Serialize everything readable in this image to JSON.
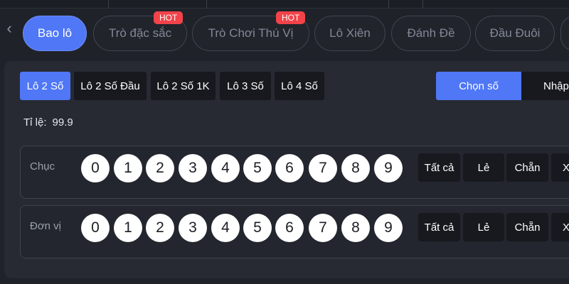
{
  "tabs": [
    {
      "label": "Bao lô",
      "active": true,
      "hot": false
    },
    {
      "label": "Trò đặc sắc",
      "active": false,
      "hot": true
    },
    {
      "label": "Trò Chơi Thú Vị",
      "active": false,
      "hot": true
    },
    {
      "label": "Lô Xiên",
      "active": false,
      "hot": false
    },
    {
      "label": "Đánh Đề",
      "active": false,
      "hot": false
    },
    {
      "label": "Đầu Đuôi",
      "active": false,
      "hot": false
    }
  ],
  "hot_badge": "HOT",
  "subtabs": [
    {
      "label": "Lô 2 Số",
      "active": true
    },
    {
      "label": "Lô 2 Số Đầu",
      "active": false
    },
    {
      "label": "Lô 2 Số 1K",
      "active": false
    },
    {
      "label": "Lô 3 Số",
      "active": false
    },
    {
      "label": "Lô 4 Số",
      "active": false
    }
  ],
  "mode": {
    "select_label": "Chọn số",
    "input_label": "Nhập"
  },
  "ratio": {
    "label": "Tỉ lệ:",
    "value": "99.9"
  },
  "rows": [
    {
      "label": "Chục",
      "digits": [
        "0",
        "1",
        "2",
        "3",
        "4",
        "5",
        "6",
        "7",
        "8",
        "9"
      ]
    },
    {
      "label": "Đơn vị",
      "digits": [
        "0",
        "1",
        "2",
        "3",
        "4",
        "5",
        "6",
        "7",
        "8",
        "9"
      ]
    }
  ],
  "quick_picks": [
    "Tất cả",
    "Lẻ",
    "Chẵn",
    "X"
  ],
  "colors": {
    "accent": "#4f77f6",
    "hot": "#f2434a",
    "background": "#1f2229"
  }
}
